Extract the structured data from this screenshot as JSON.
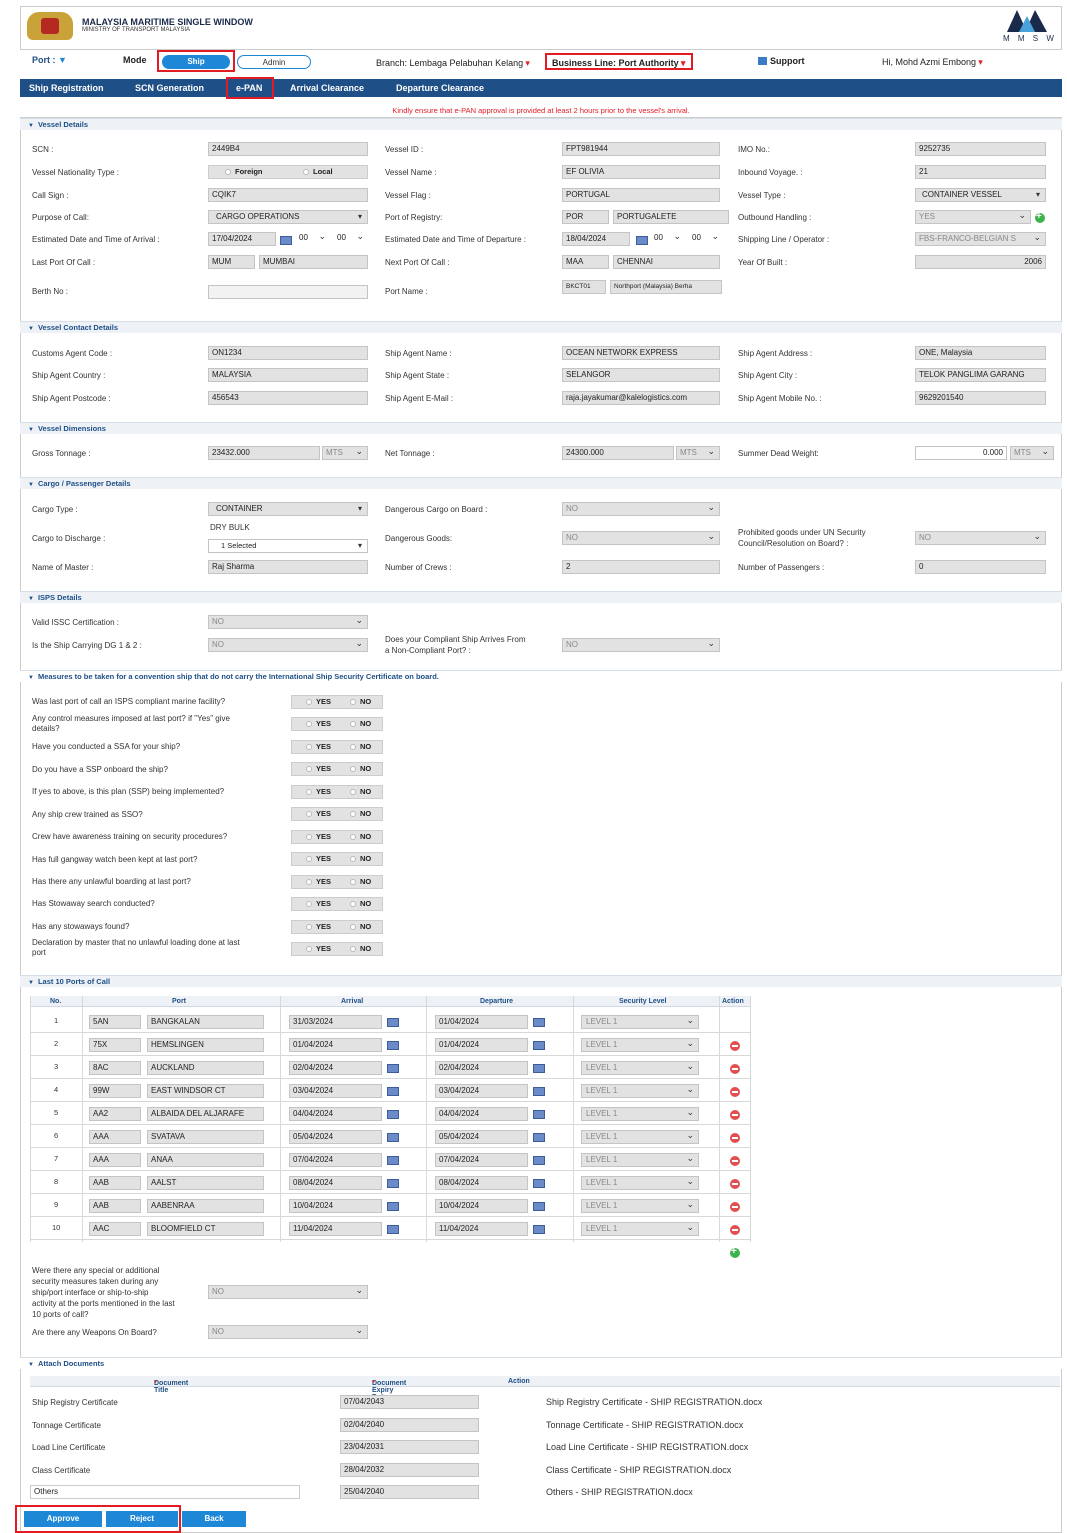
{
  "header": {
    "title": "MALAYSIA MARITIME SINGLE WINDOW",
    "subtitle": "MINISTRY OF TRANSPORT MALAYSIA",
    "brand": "M M S W"
  },
  "topbar": {
    "port_label": "Port :",
    "mode_label": "Mode",
    "mode_ship": "Ship",
    "mode_admin": "Admin",
    "branch": "Branch: Lembaga Pelabuhan Kelang",
    "business_line": "Business Line: Port Authority",
    "support": "Support",
    "user": "Hi, Mohd Azmi Embong"
  },
  "menu": {
    "items": [
      "Ship Registration",
      "SCN Generation",
      "e-PAN",
      "Arrival Clearance",
      "Departure Clearance"
    ]
  },
  "notice": "Kindly ensure that e-PAN approval is provided at least 2 hours prior to the vessel's arrival.",
  "vessel": {
    "section": "Vessel Details",
    "scn_l": "SCN :",
    "scn": "2449B4",
    "vid_l": "Vessel ID :",
    "vid": "FPT981944",
    "imo_l": "IMO No.:",
    "imo": "9252735",
    "nat_l": "Vessel Nationality Type :",
    "nat_foreign": "Foreign",
    "nat_local": "Local",
    "name_l": "Vessel Name :",
    "name": "EF OLIVIA",
    "inv_l": "Inbound Voyage. :",
    "inv": "21",
    "call_l": "Call Sign :",
    "call": "CQIK7",
    "flag_l": "Vessel Flag :",
    "flag": "PORTUGAL",
    "type_l": "Vessel Type :",
    "type": "CONTAINER VESSEL",
    "purpose_l": "Purpose of Call:",
    "purpose": "CARGO OPERATIONS",
    "reg_l": "Port of Registry:",
    "reg_code": "POR",
    "reg_name": "PORTUGALETE",
    "outb_l": "Outbound Handling :",
    "outb": "YES",
    "eta_l": "Estimated Date and Time of Arrival :",
    "eta_date": "17/04/2024",
    "eta_h": "00",
    "eta_m": "00",
    "etd_l": "Estimated Date and Time of Departure :",
    "etd_date": "18/04/2024",
    "etd_h": "00",
    "etd_m": "00",
    "line_l": "Shipping Line / Operator :",
    "line": "FBS-FRANCO-BELGIAN S",
    "lpc_l": "Last Port Of Call :",
    "lpc_code": "MUM",
    "lpc_name": "MUMBAI",
    "npc_l": "Next Port Of Call :",
    "npc_code": "MAA",
    "npc_name": "CHENNAI",
    "yob_l": "Year Of Built :",
    "yob": "2006",
    "berth_l": "Berth No :",
    "berth": "",
    "pname_l": "Port Name :",
    "pname_code": "BKCT01",
    "pname": "Northport (Malaysia) Berha"
  },
  "contact": {
    "section": "Vessel Contact Details",
    "cac_l": "Customs Agent Code :",
    "cac": "ON1234",
    "san_l": "Ship Agent Name :",
    "san": "OCEAN NETWORK EXPRESS",
    "saa_l": "Ship Agent Address :",
    "saa": "ONE, Malaysia",
    "sac_l": "Ship Agent Country :",
    "sac": "MALAYSIA",
    "sas_l": "Ship Agent State :",
    "sas": "SELANGOR",
    "saci_l": "Ship Agent City :",
    "saci": "TELOK PANGLIMA GARANG",
    "sap_l": "Ship Agent Postcode :",
    "sap": "456543",
    "sae_l": "Ship Agent E-Mail :",
    "sae": "raja.jayakumar@kalelogistics.com",
    "sam_l": "Ship Agent Mobile No. :",
    "sam": "9629201540"
  },
  "dims": {
    "section": "Vessel Dimensions",
    "gt_l": "Gross Tonnage :",
    "gt": "23432.000",
    "gt_u": "MTS",
    "nt_l": "Net Tonnage :",
    "nt": "24300.000",
    "nt_u": "MTS",
    "sdw_l": "Summer Dead Weight:",
    "sdw": "0.000",
    "sdw_u": "MTS"
  },
  "cargo": {
    "section": "Cargo / Passenger Details",
    "ct_l": "Cargo Type :",
    "ct": "CONTAINER",
    "dg_l": "Dangerous Cargo on Board :",
    "dg": "NO",
    "cd_l": "Cargo to Discharge :",
    "cd_text": "DRY BULK",
    "cd": "1 Selected",
    "dgg_l": "Dangerous Goods:",
    "dgg": "NO",
    "pg_l": "Prohibited goods under UN Security",
    "pg_l2": "Council/Resolution on Board? :",
    "pg": "NO",
    "nm_l": "Name of Master :",
    "nm": "Raj Sharma",
    "nc_l": "Number of Crews :",
    "nc": "2",
    "np_l": "Number of Passengers :",
    "np": "0"
  },
  "isps": {
    "section": "ISPS Details",
    "vic_l": "Valid ISSC Certification :",
    "vic": "NO",
    "dg12_l": "Is the Ship Carrying DG 1 & 2 :",
    "dg12": "NO",
    "ncp_l": "Does your Compliant Ship Arrives From",
    "ncp_l2": "a Non-Compliant Port? :",
    "ncp": "NO"
  },
  "measures": {
    "section": "Measures to be taken for a convention ship that do not carry the International Ship Security Certificate on board.",
    "yes": "YES",
    "no": "NO",
    "questions": [
      {
        "q": "Was last port of call an ISPS compliant marine facility?",
        "q2": ""
      },
      {
        "q": "Any control measures imposed at last port? if \"Yes\" give",
        "q2": "details?"
      },
      {
        "q": "Have you conducted a SSA for your ship?",
        "q2": ""
      },
      {
        "q": "Do you have a SSP onboard the ship?",
        "q2": ""
      },
      {
        "q": "If yes to above, is this plan (SSP) being implemented?",
        "q2": ""
      },
      {
        "q": "Any ship crew trained as SSO?",
        "q2": ""
      },
      {
        "q": "Crew have awareness training on security procedures?",
        "q2": ""
      },
      {
        "q": "Has full gangway watch been kept at last port?",
        "q2": ""
      },
      {
        "q": "Has there any unlawful boarding at last port?",
        "q2": ""
      },
      {
        "q": "Has Stowaway search conducted?",
        "q2": ""
      },
      {
        "q": "Has any stowaways found?",
        "q2": ""
      },
      {
        "q": "Declaration by master that no unlawful loading done at last",
        "q2": "port"
      }
    ]
  },
  "ports": {
    "section": "Last 10 Ports of Call",
    "headers": [
      "No.",
      "Port",
      "Arrival",
      "Departure",
      "Security Level",
      "Action"
    ],
    "rows": [
      {
        "no": "1",
        "code": "5AN",
        "name": "BANGKALAN",
        "arr": "31/03/2024",
        "dep": "01/04/2024",
        "level": "LEVEL 1"
      },
      {
        "no": "2",
        "code": "75X",
        "name": "HEMSLINGEN",
        "arr": "01/04/2024",
        "dep": "01/04/2024",
        "level": "LEVEL 1"
      },
      {
        "no": "3",
        "code": "8AC",
        "name": "AUCKLAND",
        "arr": "02/04/2024",
        "dep": "02/04/2024",
        "level": "LEVEL 1"
      },
      {
        "no": "4",
        "code": "99W",
        "name": "EAST WINDSOR CT",
        "arr": "03/04/2024",
        "dep": "03/04/2024",
        "level": "LEVEL 1"
      },
      {
        "no": "5",
        "code": "AA2",
        "name": "ALBAIDA DEL ALJARAFE",
        "arr": "04/04/2024",
        "dep": "04/04/2024",
        "level": "LEVEL 1"
      },
      {
        "no": "6",
        "code": "AAA",
        "name": "SVATAVA",
        "arr": "05/04/2024",
        "dep": "05/04/2024",
        "level": "LEVEL 1"
      },
      {
        "no": "7",
        "code": "AAA",
        "name": "ANAA",
        "arr": "07/04/2024",
        "dep": "07/04/2024",
        "level": "LEVEL 1"
      },
      {
        "no": "8",
        "code": "AAB",
        "name": "AALST",
        "arr": "08/04/2024",
        "dep": "08/04/2024",
        "level": "LEVEL 1"
      },
      {
        "no": "9",
        "code": "AAB",
        "name": "AABENRAA",
        "arr": "10/04/2024",
        "dep": "10/04/2024",
        "level": "LEVEL 1"
      },
      {
        "no": "10",
        "code": "AAC",
        "name": "BLOOMFIELD CT",
        "arr": "11/04/2024",
        "dep": "11/04/2024",
        "level": "LEVEL 1"
      }
    ],
    "special_q": [
      "Were there any special or additional",
      "security measures taken during any",
      "ship/port interface or ship-to-ship",
      "activity at the ports mentioned in the last",
      "10 ports of call?"
    ],
    "special": "NO",
    "weapons_l": "Are there any Weapons On Board?",
    "weapons": "NO"
  },
  "docs": {
    "section": "Attach Documents",
    "headers": [
      "Document Title",
      "Document Expiry Date",
      "Action"
    ],
    "req": "*",
    "rows": [
      {
        "title": "Ship Registry Certificate",
        "date": "07/04/2043",
        "file": "Ship Registry Certificate - SHIP REGISTRATION.docx"
      },
      {
        "title": "Tonnage Certificate",
        "date": "02/04/2040",
        "file": "Tonnage Certificate - SHIP REGISTRATION.docx"
      },
      {
        "title": "Load Line Certificate",
        "date": "23/04/2031",
        "file": "Load Line Certificate - SHIP REGISTRATION.docx"
      },
      {
        "title": "Class Certificate",
        "date": "28/04/2032",
        "file": "Class Certificate - SHIP REGISTRATION.docx"
      },
      {
        "title": "Others",
        "date": "25/04/2040",
        "file": "Others - SHIP REGISTRATION.docx"
      }
    ]
  },
  "buttons": {
    "approve": "Approve",
    "reject": "Reject",
    "back": "Back"
  },
  "colors": {
    "menu": "#1e4f86",
    "button": "#1e87d6",
    "highlight": "#e31b23",
    "field": "#e2e2e2"
  }
}
